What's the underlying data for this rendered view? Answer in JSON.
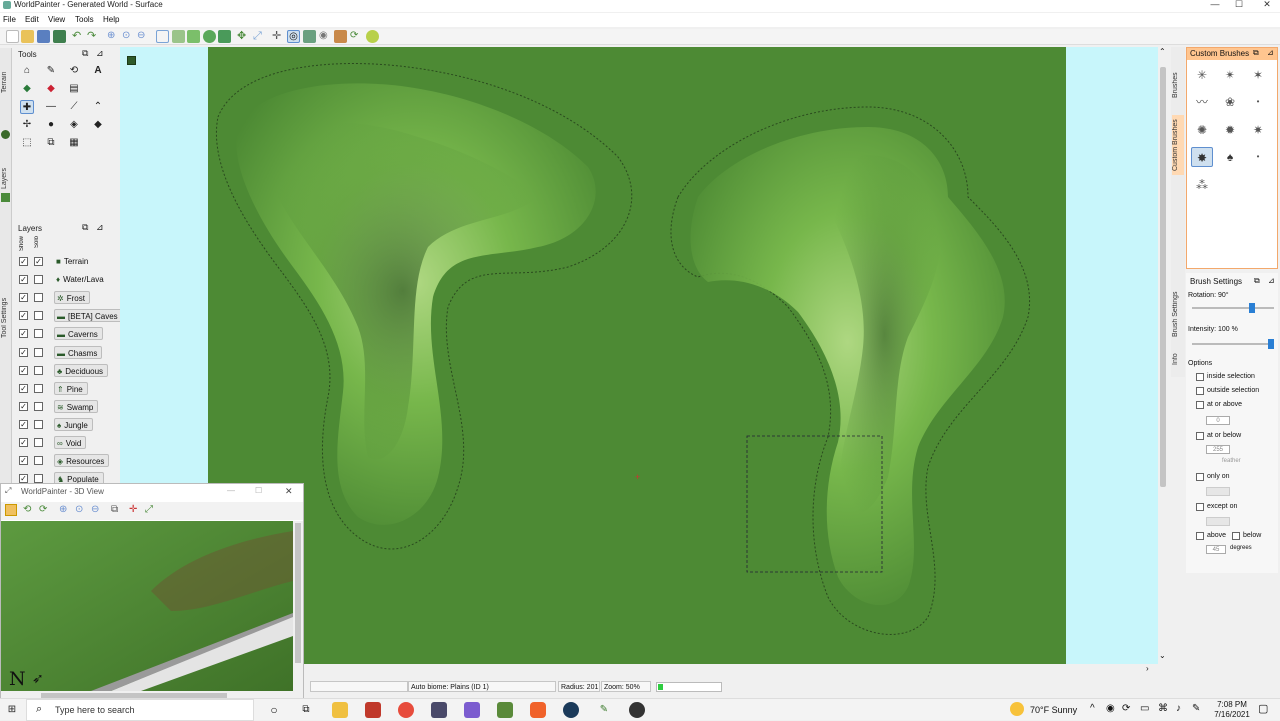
{
  "window": {
    "title": "WorldPainter - Generated World - Surface",
    "controls": [
      "—",
      "☐",
      "✕"
    ]
  },
  "menu": [
    "File",
    "Edit",
    "View",
    "Tools",
    "Help"
  ],
  "tools_panel": {
    "title": "Tools"
  },
  "layers_panel": {
    "title": "Layers",
    "col_headers": [
      "Show",
      "Solo"
    ],
    "items": [
      {
        "label": "Terrain",
        "icon": "cube-icon",
        "solo": true,
        "button": false
      },
      {
        "label": "Water/Lava",
        "icon": "water-drop-icon",
        "solo": false,
        "button": false
      },
      {
        "label": "Frost",
        "icon": "snowflake-icon",
        "solo": false,
        "button": true
      },
      {
        "label": "[BETA] Caves",
        "icon": "cave-icon",
        "solo": false,
        "button": true
      },
      {
        "label": "Caverns",
        "icon": "cave-icon",
        "solo": false,
        "button": true
      },
      {
        "label": "Chasms",
        "icon": "cave-icon",
        "solo": false,
        "button": true
      },
      {
        "label": "Deciduous",
        "icon": "tree-icon",
        "solo": false,
        "button": true
      },
      {
        "label": "Pine",
        "icon": "pine-icon",
        "solo": false,
        "button": true
      },
      {
        "label": "Swamp",
        "icon": "swamp-icon",
        "solo": false,
        "button": true
      },
      {
        "label": "Jungle",
        "icon": "jungle-icon",
        "solo": false,
        "button": true
      },
      {
        "label": "Void",
        "icon": "void-icon",
        "solo": false,
        "button": true
      },
      {
        "label": "Resources",
        "icon": "resources-icon",
        "solo": false,
        "button": true
      },
      {
        "label": "Populate",
        "icon": "populate-icon",
        "solo": false,
        "button": true
      }
    ]
  },
  "left_tabs": [
    "Terrain",
    "Layers",
    "Tool Settings"
  ],
  "view3d": {
    "title": "WorldPainter - 3D View"
  },
  "right_tabs": [
    "Brushes",
    "Custom Brushes",
    "Brush Settings",
    "Info"
  ],
  "custom_brushes": {
    "title": "Custom Brushes"
  },
  "brush_settings": {
    "title": "Brush Settings",
    "rotation": "Rotation: 90°",
    "rotation_level": 0.75,
    "intensity": "Intensity: 100 %",
    "intensity_level": 1.0,
    "options_title": "Options",
    "options": {
      "inside": "inside selection",
      "outside": "outside selection",
      "at_or_above": "at or above",
      "at_or_above_value": "0",
      "at_or_below": "at or below",
      "at_or_below_value": "255",
      "feather": "feather",
      "only_on": "only on",
      "except_on": "except on",
      "above": "above",
      "below": "below",
      "degrees_value": "45",
      "degrees": "degrees"
    }
  },
  "status": {
    "biome": "Auto biome: Plains (ID 1)",
    "radius": "Radius: 201",
    "zoom": "Zoom: 50%"
  },
  "taskbar": {
    "search_placeholder": "Type here to search",
    "weather": "70°F  Sunny",
    "time": "7:08 PM",
    "date": "7/16/2021"
  },
  "colors": {
    "map_green": "#4d8a34",
    "cyan": "#c8f6fb",
    "accent_orange": "#ffc58f"
  }
}
